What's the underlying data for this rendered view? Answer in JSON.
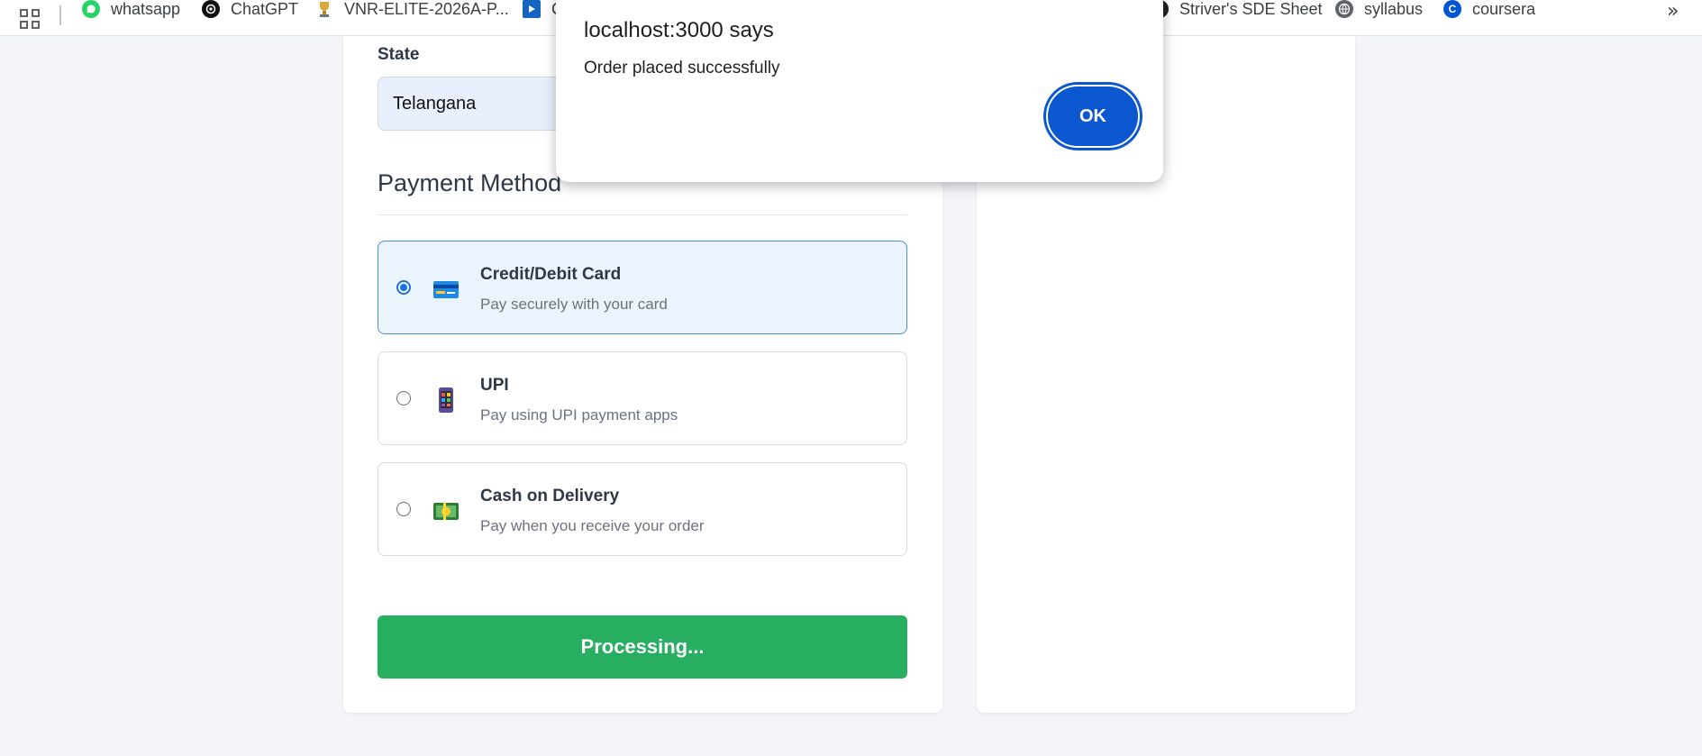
{
  "bookmarks": {
    "items": [
      {
        "label": "whatsapp",
        "icon": "whatsapp-icon",
        "color": "#25d366"
      },
      {
        "label": "ChatGPT",
        "icon": "chatgpt-icon",
        "color": "#111111"
      },
      {
        "label": "VNR-ELITE-2026A-P...",
        "icon": "trophy-icon",
        "color": "#d9a73a"
      },
      {
        "label": "C",
        "icon": "play-icon",
        "color": "#1565c0"
      },
      {
        "label": "Striver's SDE Sheet",
        "icon": "striver-icon",
        "color": "#222222"
      },
      {
        "label": "syllabus",
        "icon": "globe-icon",
        "color": "#5f6368"
      },
      {
        "label": "coursera",
        "icon": "coursera-icon",
        "color": "#0056d2"
      }
    ],
    "more_icon": "double-chevron-right-icon"
  },
  "form": {
    "state_label": "State",
    "state_value": "Telangana"
  },
  "payment": {
    "title": "Payment Method",
    "options": [
      {
        "title": "Credit/Debit Card",
        "desc": "Pay securely with your card",
        "icon": "credit-card-icon",
        "selected": true
      },
      {
        "title": "UPI",
        "desc": "Pay using UPI payment apps",
        "icon": "mobile-phone-icon",
        "selected": false
      },
      {
        "title": "Cash on Delivery",
        "desc": "Pay when you receive your order",
        "icon": "cash-icon",
        "selected": false
      }
    ],
    "submit_label": "Processing..."
  },
  "dialog": {
    "title": "localhost:3000 says",
    "message": "Order placed successfully",
    "ok_label": "OK"
  },
  "colors": {
    "accent": "#27ae60",
    "selected_bg": "#ebf4fd",
    "dialog_button": "#0b57d0"
  }
}
